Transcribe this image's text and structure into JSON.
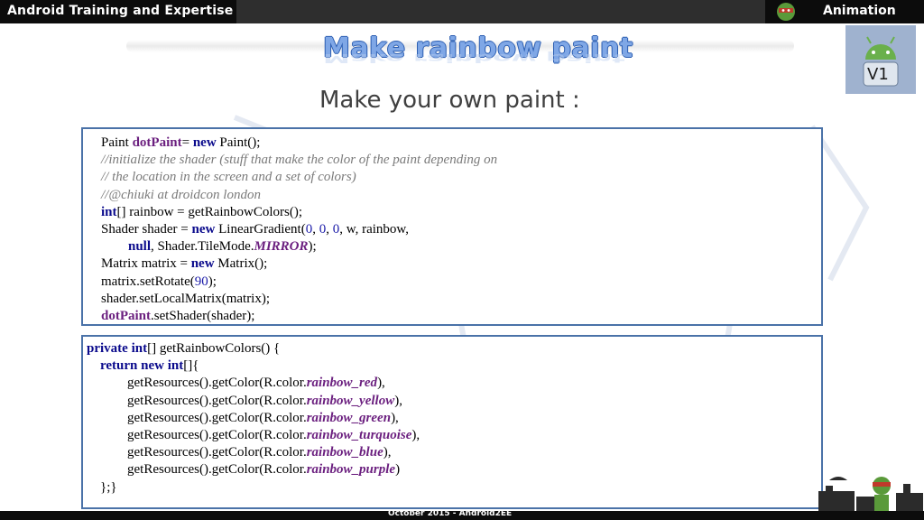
{
  "header": {
    "left_title": "Android Training and Expertise",
    "right_title": "Animation"
  },
  "slide": {
    "title": "Make rainbow paint",
    "subtitle": "Make your own paint :"
  },
  "logo": {
    "version_label": "V1",
    "color": "#9fb2cf"
  },
  "code_block_1": {
    "lines": [
      [
        {
          "t": "Paint "
        },
        {
          "t": "dotPaint",
          "c": "field"
        },
        {
          "t": "= "
        },
        {
          "t": "new",
          "c": "kw"
        },
        {
          "t": " Paint();"
        }
      ],
      [
        {
          "t": "//initialize the shader (stuff that make the color of the paint depending on",
          "c": "comment"
        }
      ],
      [
        {
          "t": "// the location in the screen and a set of colors)",
          "c": "comment"
        }
      ],
      [
        {
          "t": "//@chiuki at droidcon london",
          "c": "comment"
        }
      ],
      [
        {
          "t": "int",
          "c": "kw"
        },
        {
          "t": "[] rainbow = getRainbowColors();"
        }
      ],
      [
        {
          "t": "Shader shader = "
        },
        {
          "t": "new",
          "c": "kw"
        },
        {
          "t": " LinearGradient("
        },
        {
          "t": "0",
          "c": "num"
        },
        {
          "t": ", "
        },
        {
          "t": "0",
          "c": "num"
        },
        {
          "t": ", "
        },
        {
          "t": "0",
          "c": "num"
        },
        {
          "t": ", w, rainbow,"
        }
      ],
      [
        {
          "t": "        "
        },
        {
          "t": "null",
          "c": "kw"
        },
        {
          "t": ", Shader.TileMode."
        },
        {
          "t": "MIRROR",
          "c": "fieldi"
        },
        {
          "t": ");"
        }
      ],
      [
        {
          "t": "Matrix matrix = "
        },
        {
          "t": "new",
          "c": "kw"
        },
        {
          "t": " Matrix();"
        }
      ],
      [
        {
          "t": "matrix.setRotate("
        },
        {
          "t": "90",
          "c": "num"
        },
        {
          "t": ");"
        }
      ],
      [
        {
          "t": "shader.setLocalMatrix(matrix);"
        }
      ],
      [
        {
          "t": "dotPaint",
          "c": "field"
        },
        {
          "t": ".setShader(shader);"
        }
      ]
    ]
  },
  "code_block_2": {
    "lines": [
      [
        {
          "t": "private int",
          "c": "kw"
        },
        {
          "t": "[] getRainbowColors() {"
        }
      ],
      [
        {
          "t": "    "
        },
        {
          "t": "return new int",
          "c": "kw"
        },
        {
          "t": "[]{"
        }
      ],
      [
        {
          "t": "            getResources().getColor(R.color."
        },
        {
          "t": "rainbow_red",
          "c": "fieldi"
        },
        {
          "t": "),"
        }
      ],
      [
        {
          "t": "            getResources().getColor(R.color."
        },
        {
          "t": "rainbow_yellow",
          "c": "fieldi"
        },
        {
          "t": "),"
        }
      ],
      [
        {
          "t": "            getResources().getColor(R.color."
        },
        {
          "t": "rainbow_green",
          "c": "fieldi"
        },
        {
          "t": "),"
        }
      ],
      [
        {
          "t": "            getResources().getColor(R.color."
        },
        {
          "t": "rainbow_turquoise",
          "c": "fieldi"
        },
        {
          "t": "),"
        }
      ],
      [
        {
          "t": "            getResources().getColor(R.color."
        },
        {
          "t": "rainbow_blue",
          "c": "fieldi"
        },
        {
          "t": "),"
        }
      ],
      [
        {
          "t": "            getResources().getColor(R.color."
        },
        {
          "t": "rainbow_purple",
          "c": "fieldi"
        },
        {
          "t": ")"
        }
      ],
      [
        {
          "t": "    };}"
        }
      ]
    ]
  },
  "footer": {
    "text": "October 2015 - Android2EE"
  },
  "colors": {
    "frame_border": "#4a72a8",
    "keyword": "#0a0a8c",
    "field": "#6b1f7f",
    "title": "#7fa7e6"
  }
}
